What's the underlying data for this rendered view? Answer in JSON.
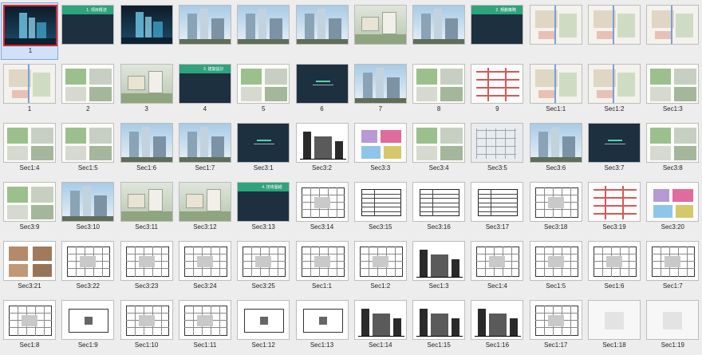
{
  "rows": [
    [
      {
        "label": "1",
        "kind": "night",
        "selected": true
      },
      {
        "label": "",
        "kind": "cover",
        "title": "1. 項目概述"
      },
      {
        "label": "",
        "kind": "night"
      },
      {
        "label": "",
        "kind": "photo"
      },
      {
        "label": "",
        "kind": "photo"
      },
      {
        "label": "",
        "kind": "photo"
      },
      {
        "label": "",
        "kind": "aerial"
      },
      {
        "label": "",
        "kind": "photo"
      },
      {
        "label": "",
        "kind": "cover",
        "title": "2. 規劃策略"
      },
      {
        "label": "",
        "kind": "map"
      },
      {
        "label": "",
        "kind": "map"
      },
      {
        "label": "",
        "kind": "map"
      }
    ],
    [
      {
        "label": "1",
        "kind": "map"
      },
      {
        "label": "2",
        "kind": "green"
      },
      {
        "label": "3",
        "kind": "aerial"
      },
      {
        "label": "4",
        "kind": "cover",
        "title": "3. 建築設計"
      },
      {
        "label": "5",
        "kind": "green"
      },
      {
        "label": "6",
        "kind": "dark"
      },
      {
        "label": "7",
        "kind": "photo"
      },
      {
        "label": "8",
        "kind": "green"
      },
      {
        "label": "9",
        "kind": "redgrid"
      },
      {
        "label": "Sec1:1",
        "kind": "map"
      },
      {
        "label": "Sec1:2",
        "kind": "map"
      },
      {
        "label": "Sec1:3",
        "kind": "green"
      }
    ],
    [
      {
        "label": "Sec1:4",
        "kind": "green"
      },
      {
        "label": "Sec1:5",
        "kind": "green"
      },
      {
        "label": "Sec1:6",
        "kind": "photo"
      },
      {
        "label": "Sec1:7",
        "kind": "photo"
      },
      {
        "label": "Sec3:1",
        "kind": "dark"
      },
      {
        "label": "Sec3:2",
        "kind": "elev"
      },
      {
        "label": "Sec3:3",
        "kind": "purple"
      },
      {
        "label": "Sec3:4",
        "kind": "green"
      },
      {
        "label": "Sec3:5",
        "kind": "facade"
      },
      {
        "label": "Sec3:6",
        "kind": "photo"
      },
      {
        "label": "Sec3:7",
        "kind": "dark"
      },
      {
        "label": "Sec3:8",
        "kind": "green"
      }
    ],
    [
      {
        "label": "Sec3:9",
        "kind": "green"
      },
      {
        "label": "Sec3:10",
        "kind": "photo"
      },
      {
        "label": "Sec3:11",
        "kind": "aerial"
      },
      {
        "label": "Sec3:12",
        "kind": "aerial"
      },
      {
        "label": "Sec3:13",
        "kind": "cover",
        "title": "4. 技術圖紙"
      },
      {
        "label": "Sec3:14",
        "kind": "plan"
      },
      {
        "label": "Sec3:15",
        "kind": "table"
      },
      {
        "label": "Sec3:16",
        "kind": "table"
      },
      {
        "label": "Sec3:17",
        "kind": "table"
      },
      {
        "label": "Sec3:18",
        "kind": "plan"
      },
      {
        "label": "Sec3:19",
        "kind": "redgrid"
      },
      {
        "label": "Sec3:20",
        "kind": "purple"
      }
    ],
    [
      {
        "label": "Sec3:21",
        "kind": "brown"
      },
      {
        "label": "Sec3:22",
        "kind": "plan"
      },
      {
        "label": "Sec3:23",
        "kind": "plan"
      },
      {
        "label": "Sec3:24",
        "kind": "plan"
      },
      {
        "label": "Sec3:25",
        "kind": "plan"
      },
      {
        "label": "Sec1:1",
        "kind": "plan"
      },
      {
        "label": "Sec1:2",
        "kind": "plan"
      },
      {
        "label": "Sec1:3",
        "kind": "elev"
      },
      {
        "label": "Sec1:4",
        "kind": "plan"
      },
      {
        "label": "Sec1:5",
        "kind": "plan"
      },
      {
        "label": "Sec1:6",
        "kind": "plan"
      },
      {
        "label": "Sec1:7",
        "kind": "plan"
      }
    ],
    [
      {
        "label": "Sec1:8",
        "kind": "plan"
      },
      {
        "label": "Sec1:9",
        "kind": "sparse"
      },
      {
        "label": "Sec1:10",
        "kind": "plan"
      },
      {
        "label": "Sec1:11",
        "kind": "plan"
      },
      {
        "label": "Sec1:12",
        "kind": "sparse"
      },
      {
        "label": "Sec1:13",
        "kind": "sparse"
      },
      {
        "label": "Sec1:14",
        "kind": "elev"
      },
      {
        "label": "Sec1:15",
        "kind": "elev"
      },
      {
        "label": "Sec1:16",
        "kind": "elev"
      },
      {
        "label": "Sec1:17",
        "kind": "plan"
      },
      {
        "label": "Sec1:18",
        "kind": "blank"
      },
      {
        "label": "Sec1:19",
        "kind": "blank"
      }
    ]
  ],
  "colors": {
    "dark": "#1d3040",
    "teal": "#2fa37c",
    "accent_red": "#d9252b",
    "select_bg": "#cfe2f8"
  }
}
